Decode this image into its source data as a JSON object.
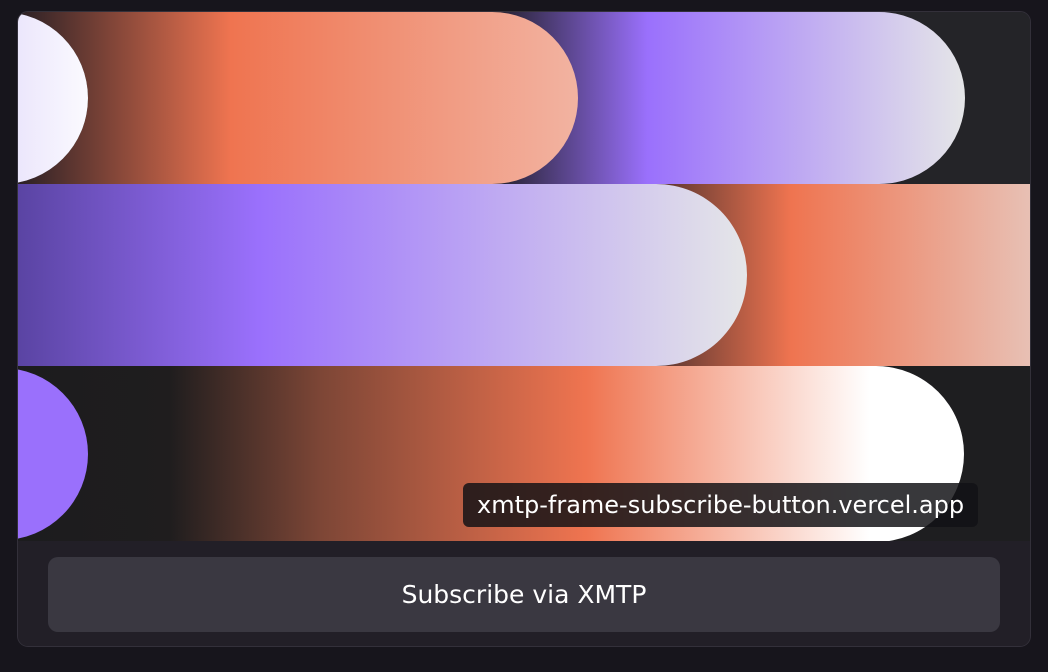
{
  "frame": {
    "image": {
      "description_icon": "abstract-gradient-pills-artwork",
      "colors": {
        "orange": "#ef7450",
        "purple": "#9a70fc",
        "light_gray": "#e5e6e8",
        "dark": "#1c1c1e",
        "white": "#ffffff"
      }
    },
    "url_label": "xmtp-frame-subscribe-button.vercel.app"
  },
  "buttons": {
    "subscribe_label": "Subscribe via XMTP"
  }
}
